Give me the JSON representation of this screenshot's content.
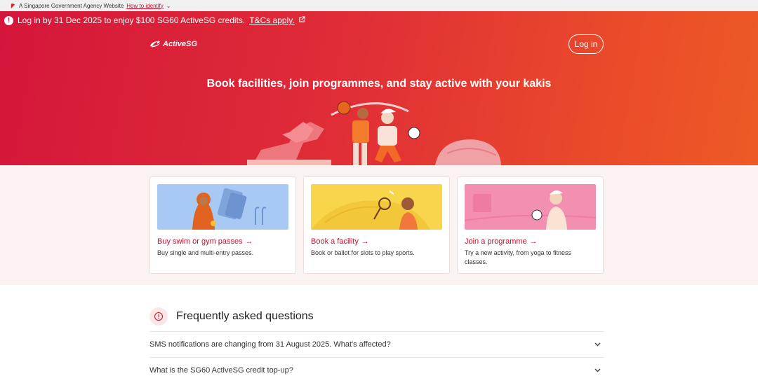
{
  "masthead": {
    "text": "A Singapore Government Agency Website",
    "identify_link": "How to identify",
    "chevron": "chevron-down-icon"
  },
  "banner": {
    "message": "Log in by 31 Dec 2025 to enjoy $100 SG60 ActiveSG credits.",
    "link": "T&Cs apply.",
    "alert_glyph": "!",
    "external_icon": "external-link-icon"
  },
  "header": {
    "logo_text": "ActiveSG",
    "login_label": "Log in"
  },
  "hero": {
    "title": "Book facilities, join programmes, and stay active with your kakis"
  },
  "cards": [
    {
      "title": "Buy swim or gym passes",
      "arrow": "→",
      "description": "Buy single and multi-entry passes."
    },
    {
      "title": "Book a facility",
      "arrow": "→",
      "description": "Book or ballot for slots to play sports."
    },
    {
      "title": "Join a programme",
      "arrow": "→",
      "description": "Try a new activity, from yoga to fitness classes."
    }
  ],
  "faq": {
    "title": "Frequently asked questions",
    "icon_glyph": "!",
    "items": [
      {
        "question": "SMS notifications are changing from 31 August 2025. What's affected?"
      },
      {
        "question": "What is the SG60 ActiveSG credit top-up?"
      }
    ]
  },
  "colors": {
    "brand_red": "#c8102e",
    "hero_start": "#d4163a",
    "hero_end": "#ee5a25"
  }
}
